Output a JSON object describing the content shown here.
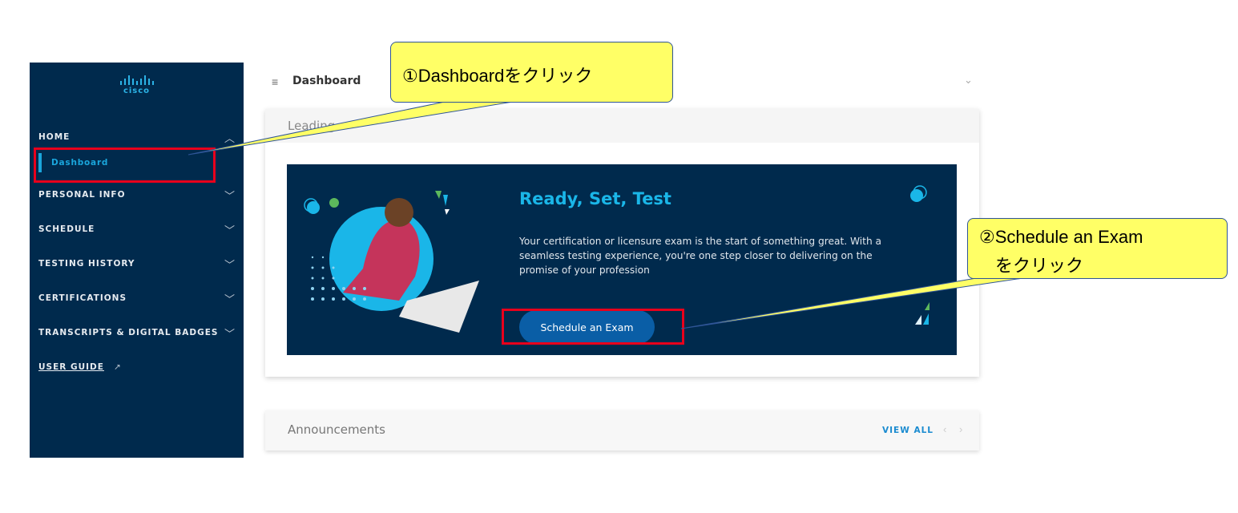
{
  "sidebar": {
    "logo": "cisco",
    "items": [
      {
        "label": "HOME",
        "expanded": true
      },
      {
        "label": "PERSONAL INFO"
      },
      {
        "label": "SCHEDULE"
      },
      {
        "label": "TESTING HISTORY"
      },
      {
        "label": "CERTIFICATIONS"
      },
      {
        "label": "TRANSCRIPTS & DIGITAL BADGES"
      }
    ],
    "active_sub_item": "Dashboard",
    "user_guide": "USER GUIDE"
  },
  "topbar": {
    "title": "Dashboard",
    "menu_icon": "≡",
    "chevron": "⌄"
  },
  "card": {
    "header": "Leading",
    "banner": {
      "title": "Ready, Set, Test",
      "text": "Your certification or licensure exam is the start of something great. With a seamless testing experience, you're one step closer to delivering on the promise of your profession",
      "button": "Schedule an Exam"
    }
  },
  "announcements": {
    "title": "Announcements",
    "view_all": "VIEW ALL"
  },
  "callouts": {
    "one": "①Dashboardをクリック",
    "two_line1": "②Schedule an Exam",
    "two_line2": "をクリック"
  },
  "colors": {
    "sidebar": "#002a4d",
    "accent": "#1aa6dc",
    "button": "#0a5ea6",
    "highlight": "#e8001c",
    "callout": "#ffff66"
  }
}
